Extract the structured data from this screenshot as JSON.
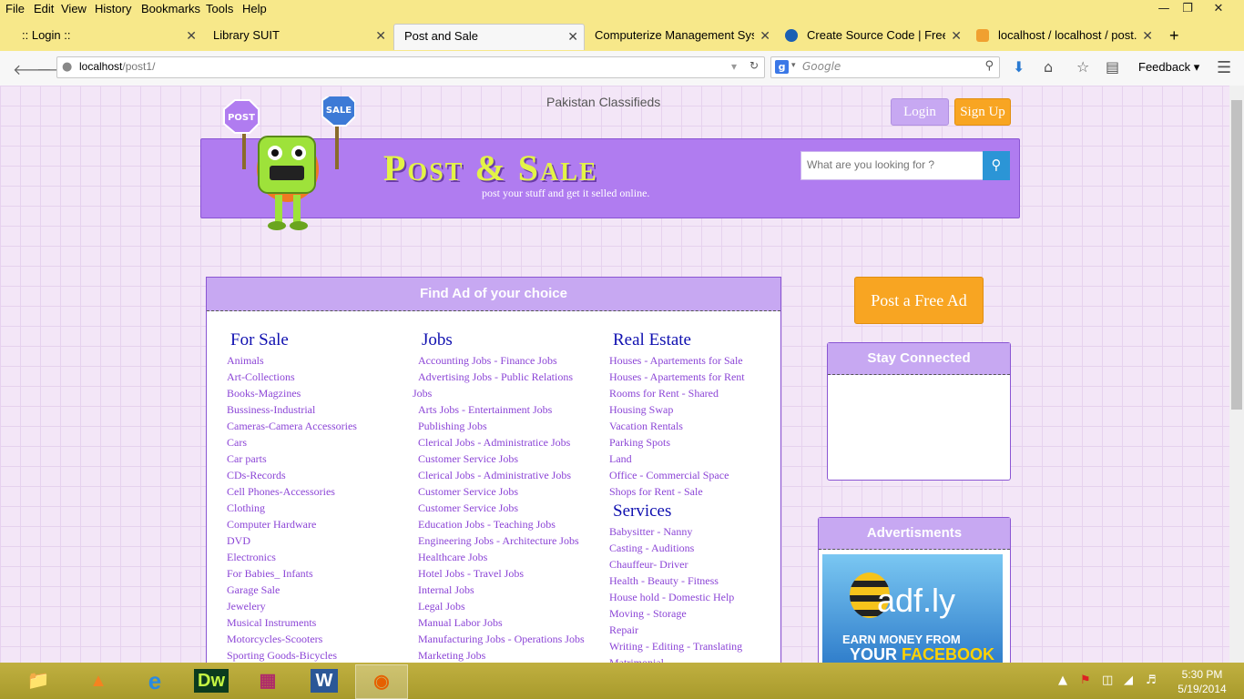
{
  "menu": [
    "File",
    "Edit",
    "View",
    "History",
    "Bookmarks",
    "Tools",
    "Help"
  ],
  "tabs": [
    {
      "label": ":: Login ::"
    },
    {
      "label": "Library SUIT"
    },
    {
      "label": "Post and Sale"
    },
    {
      "label": "Computerize Management Sys..."
    },
    {
      "label": "Create Source Code | Free s..."
    },
    {
      "label": "localhost / localhost / post..."
    }
  ],
  "url": {
    "host": "localhost",
    "path": "/post1/"
  },
  "search_engine": {
    "placeholder": "Google"
  },
  "toolbar": {
    "feedback": "Feedback"
  },
  "site": {
    "topline": "Pakistan Classifieds",
    "login": "Login",
    "signup": "Sign Up",
    "brand": "Post & Sale",
    "tagline": "post your stuff and get it selled online.",
    "search_placeholder": "What are you looking for ?",
    "post_ad": "Post a Free Ad",
    "robot_signs": [
      "POST",
      "SALE"
    ]
  },
  "find_panel": {
    "title": "Find Ad of your choice",
    "for_sale": {
      "title": "For Sale",
      "items": [
        "Animals",
        "Art-Collections",
        "Books-Magzines",
        "Bussiness-Industrial",
        "Cameras-Camera Accessories",
        "Cars",
        "Car parts",
        "CDs-Records",
        "Cell Phones-Accessories",
        "Clothing",
        "Computer Hardware",
        "DVD",
        "Electronics",
        "For Babies_ Infants",
        "Garage Sale",
        "Jewelery",
        "Musical Instruments",
        "Motorcycles-Scooters",
        "Sporting Goods-Bicycles"
      ]
    },
    "jobs": {
      "title": "Jobs",
      "items": [
        "Accounting Jobs - Finance Jobs",
        "Advertising Jobs - Public Relations Jobs",
        "Arts Jobs - Entertainment Jobs",
        "Publishing Jobs",
        "Clerical Jobs - Administratice Jobs",
        "Customer Service Jobs",
        "Clerical Jobs - Administrative Jobs",
        "Customer Service Jobs",
        "Customer Service Jobs",
        "Education Jobs - Teaching Jobs",
        "Engineering Jobs - Architecture Jobs",
        "Healthcare Jobs",
        "Hotel Jobs - Travel Jobs",
        "Internal Jobs",
        "Legal Jobs",
        "Manual Labor Jobs",
        "Manufacturing Jobs - Operations Jobs",
        "Marketing Jobs"
      ]
    },
    "real_estate": {
      "title": "Real Estate",
      "items": [
        "Houses - Apartements for Sale",
        "Houses - Apartements for Rent",
        "Rooms for Rent - Shared",
        "Housing Swap",
        "Vacation Rentals",
        "Parking Spots",
        "Land",
        "Office - Commercial Space",
        "Shops for Rent - Sale"
      ]
    },
    "services": {
      "title": "Services",
      "items": [
        "Babysitter - Nanny",
        "Casting - Auditions",
        "Chauffeur- Driver",
        "Health - Beauty - Fitness",
        "House hold - Domestic Help",
        "Moving - Storage",
        "Repair",
        "Writing - Editing - Translating",
        "Matrimonial"
      ]
    }
  },
  "sidebar": {
    "stay_connected": "Stay Connected",
    "advertisments": "Advertisments",
    "ad": {
      "logo": "adf.ly",
      "line1": "EARN MONEY FROM",
      "line2a": "YOUR",
      "line2b": "FACEBOOK &"
    }
  },
  "taskbar": {
    "apps": [
      "file-explorer",
      "vlc",
      "internet-explorer",
      "dreamweaver",
      "winrar",
      "word",
      "firefox"
    ],
    "dw_label": "Dw",
    "word_label": "W",
    "time": "5:30 PM",
    "date": "5/19/2014"
  },
  "colors": {
    "accent": "#b07cf0",
    "brand_text": "#e3f346",
    "link": "#8b44d6",
    "heading": "#1010b0",
    "orange": "#f8a522"
  }
}
